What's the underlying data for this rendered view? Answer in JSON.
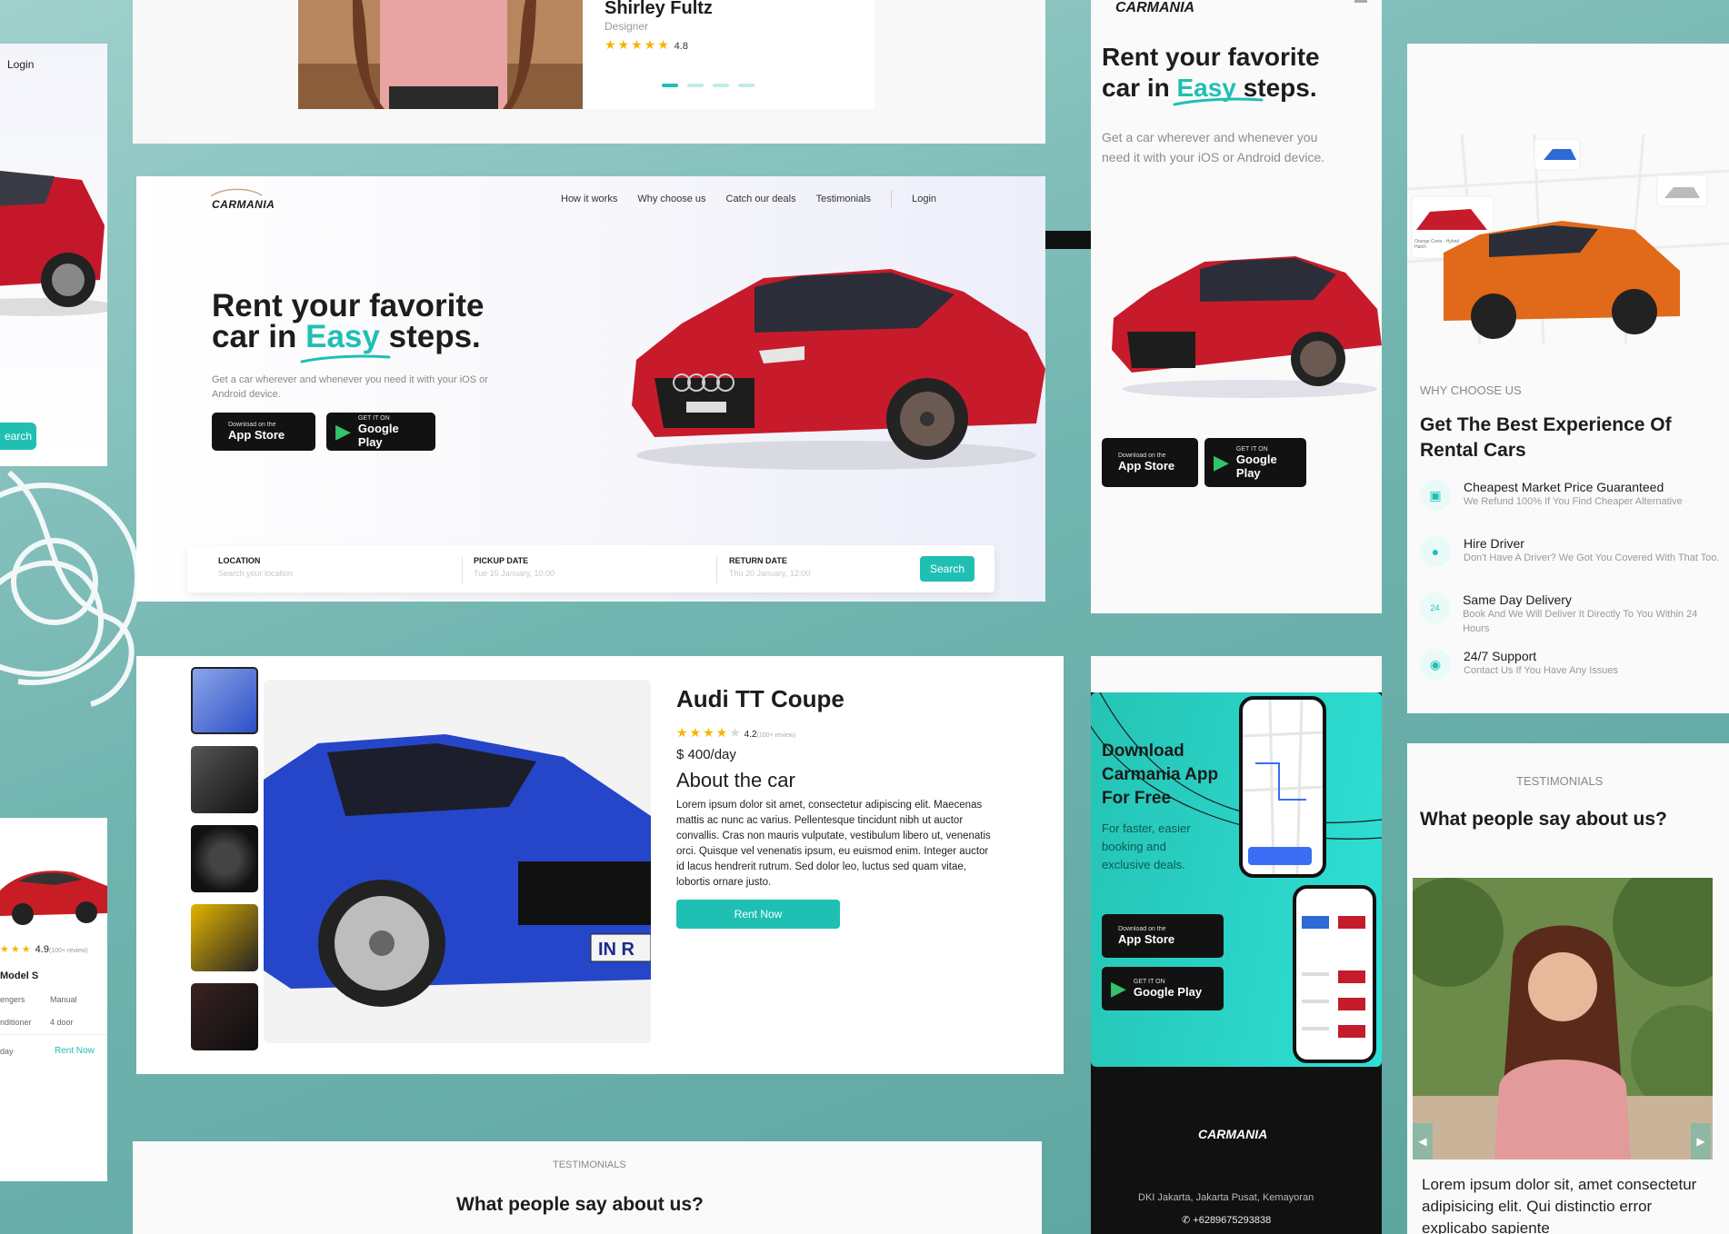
{
  "brand": "CARMANIA",
  "colors": {
    "accent": "#1fbfb4",
    "dark": "#121212",
    "bg": "#6fb3ae"
  },
  "nav": {
    "links": [
      "How it works",
      "Why choose us",
      "Catch our deals",
      "Testimonials"
    ],
    "login": "Login"
  },
  "hero": {
    "title_line1": "Rent your favorite",
    "title_line2_pre": "car in",
    "title_highlight": "Easy",
    "title_line2_post": "steps.",
    "subtitle": "Get a car wherever and whenever you need it with your iOS or Android device.",
    "subtitle_mobile": "Get a car wherever and whenever you need it with your iOS or Android device."
  },
  "stores": {
    "apple_small": "Download on the",
    "apple_big": "App Store",
    "google_small": "GET IT ON",
    "google_big": "Google Play"
  },
  "search": {
    "location_label": "LOCATION",
    "location_placeholder": "Search your location",
    "pickup_label": "PICKUP DATE",
    "pickup_value": "Tue 15 January, 10:00",
    "return_label": "RETURN DATE",
    "return_value": "Thu 20 January, 12:00",
    "button": "Search"
  },
  "top_testimonial": {
    "name": "Shirley Fultz",
    "role": "Designer",
    "rating": "4.8"
  },
  "left_partial": {
    "login": "Login",
    "search": "earch"
  },
  "model_card": {
    "rating": "4.9",
    "reviews": "(100+ review)",
    "name": "Model S",
    "spec1": "engers",
    "spec2": "Manual",
    "spec3": "nditioner",
    "spec4": "4 door",
    "price_tail": "day",
    "cta": "Rent Now"
  },
  "detail": {
    "name": "Audi TT Coupe",
    "rating": "4.2",
    "reviews": "(100+ review)",
    "price": "$ 400/day",
    "about_title": "About the car",
    "about": "Lorem ipsum dolor sit amet, consectetur adipiscing elit. Maecenas mattis ac nunc ac varius. Pellentesque tincidunt nibh ut auctor convallis. Cras non mauris vulputate, vestibulum libero ut, venenatis orci. Quisque vel venenatis ipsum, eu euismod enim. Integer auctor id lacus hendrerit rutrum. Sed dolor leo, luctus sed quam vitae, lobortis ornare justo.",
    "cta": "Rent Now",
    "plate": "IN R"
  },
  "why": {
    "eyebrow": "WHY CHOOSE US",
    "title": "Get The Best Experience Of Rental Cars",
    "map_label": "Orange Crete - Hybrid Hatch",
    "items": [
      {
        "title": "Cheapest Market Price Guaranteed",
        "desc": "We Refund 100% If You Find Cheaper Alternative"
      },
      {
        "title": "Hire Driver",
        "desc": "Don't Have A Driver? We Got You Covered With That Too."
      },
      {
        "title": "Same Day Delivery",
        "desc": "Book And We Will Deliver It Directly To You Within 24 Hours"
      },
      {
        "title": "24/7 Support",
        "desc": "Contact Us If You Have Any Issues"
      }
    ]
  },
  "download": {
    "title": "Download Carmania App For Free",
    "subtitle": "For faster, easier booking and exclusive deals."
  },
  "footer": {
    "address": "DKI Jakarta, Jakarta Pusat, Kemayoran",
    "phone": "+6289675293838"
  },
  "testimonials": {
    "eyebrow": "TESTIMONIALS",
    "title": "What people say about us?",
    "quote": "Lorem ipsum dolor sit, amet consectetur adipisicing elit. Qui distinctio error explicabo sapiente"
  }
}
